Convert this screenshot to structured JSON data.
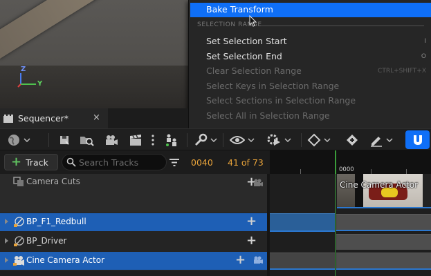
{
  "context_menu": {
    "items": [
      {
        "label": "Bake Transform",
        "shortcut": "",
        "enabled": true,
        "highlighted": true
      },
      {
        "label": "Set Selection Start",
        "shortcut": "I",
        "enabled": true
      },
      {
        "label": "Set Selection End",
        "shortcut": "O",
        "enabled": true
      },
      {
        "label": "Clear Selection Range",
        "shortcut": "CTRL+SHIFT+X",
        "enabled": false
      },
      {
        "label": "Select Keys in Selection Range",
        "shortcut": "",
        "enabled": false
      },
      {
        "label": "Select Sections in Selection Range",
        "shortcut": "",
        "enabled": false
      },
      {
        "label": "Select All in Selection Range",
        "shortcut": "",
        "enabled": false
      }
    ],
    "section_header": "SELECTION RANGE"
  },
  "viewport": {
    "axis_labels": {
      "z": "Z",
      "y": "Y"
    }
  },
  "tab": {
    "title": "Sequencer*",
    "close": "×"
  },
  "search_row": {
    "add_track_label": "Track",
    "search_placeholder": "Search Tracks",
    "current_frame": "0040",
    "frame_count": "41 of 73"
  },
  "ruler": {
    "label": "0000"
  },
  "tracks": [
    {
      "label": "Camera Cuts",
      "selected": false,
      "icon": "camera-cuts-icon"
    },
    {
      "label": "BP_F1_Redbull",
      "selected": true,
      "icon": "actor-icon"
    },
    {
      "label": "BP_Driver",
      "selected": false,
      "icon": "actor-icon"
    },
    {
      "label": "Cine Camera Actor",
      "selected": true,
      "icon": "cine-camera-icon"
    }
  ],
  "timeline": {
    "camera_clip_label": "Cine Camera Actor"
  },
  "colors": {
    "accent": "#0f6ff7",
    "selection": "#1e5fb5",
    "frame_text": "#e8a33a",
    "playhead": "#3a9d3a"
  }
}
